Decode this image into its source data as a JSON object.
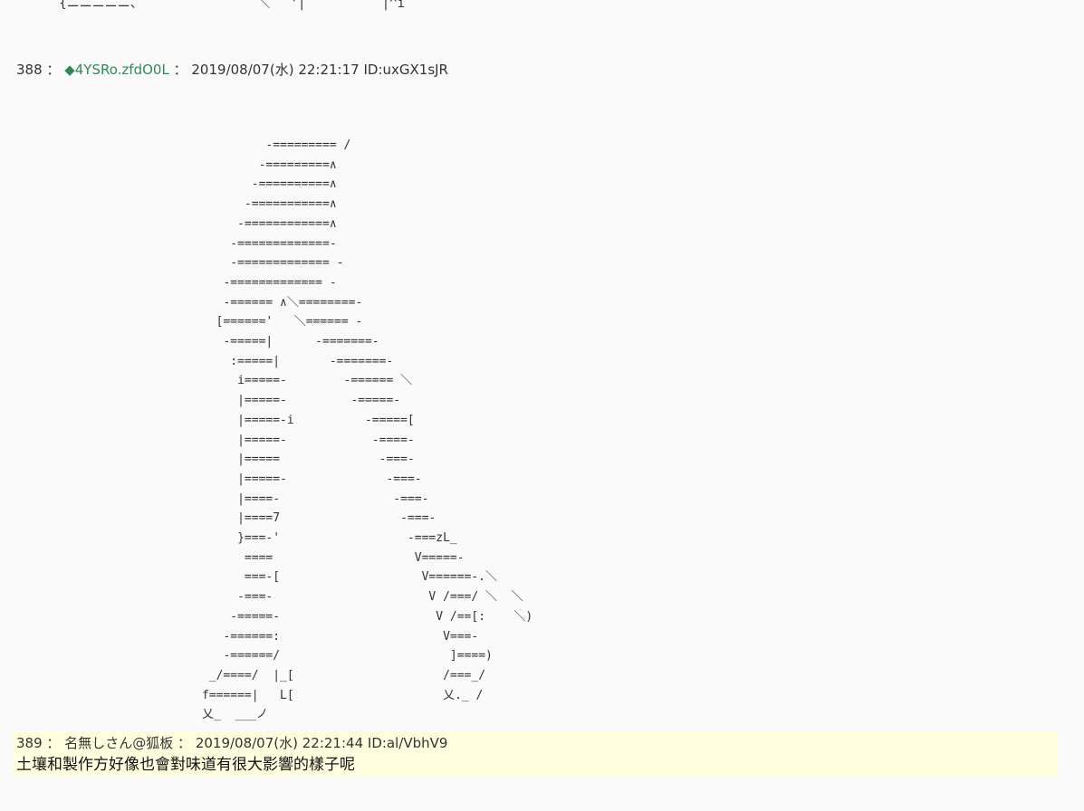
{
  "top_fragment": "   {ニニニニニ、               ＼｀ '|          |^i",
  "posts": [
    {
      "number": "388",
      "separator": "：",
      "trip_mark": "◆",
      "name": "4YSRo.zfdO0L",
      "separator2": "：",
      "date": "2019/08/07(水) 22:21:17",
      "id": "ID:uxGX1sJR",
      "ascii_art": "               -========= /\n              -=========∧\n             -==========∧\n            -===========∧\n           -============∧\n          -=============-\n          -============= -\n         -============= -\n         -====== ∧＼========-\n        [======'   ＼====== -\n         -=====|      -=======-\n          :=====|       -=======-\n           i=====-        -====== ＼\n           |=====-         -=====-\n           |=====-i          -=====[\n           |=====-            -====-\n           |=====              -===-\n           |=====-              -===-\n           |====-                -===-\n           |====7                 -===-\n           }===-'                  -===zL_\n            ====                    V=====-\n            ===-[                    V======-.＼\n           -===-                      V /===/ ＼  ＼\n          -=====-                      V /==[:    ＼)\n         -======:                       V===-\n         -======/                        ]====)\n       _/====/  |_[                     /===_/\n      f======|   L[                     乂._ /\n      乂_  ___ノ"
    },
    {
      "number": "389",
      "separator": "：",
      "name": "名無しさん@狐板",
      "separator2": "：",
      "date": "2019/08/07(水) 22:21:44",
      "id": "ID:al/VbhV9",
      "body": "土壤和製作方好像也會對味道有很大影響的樣子呢"
    }
  ]
}
